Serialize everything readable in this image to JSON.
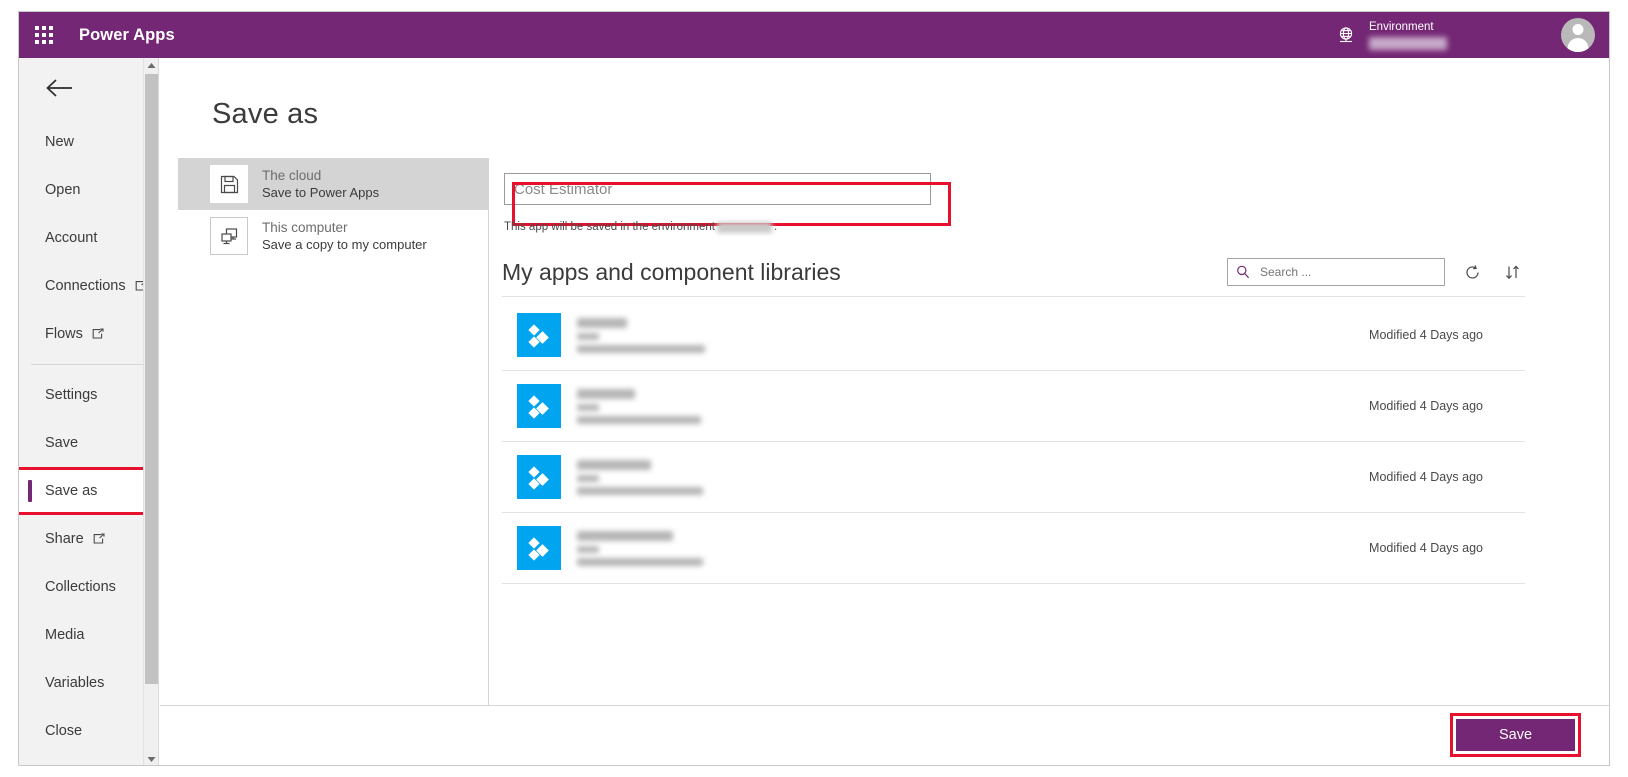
{
  "header": {
    "waffle_icon": "app-launcher-waffle-icon",
    "brand": "Power Apps",
    "environment_icon": "globe-environment-icon",
    "environment_label": "Environment",
    "environment_value": "",
    "avatar_icon": "user-avatar-icon"
  },
  "sidebar": {
    "back_icon": "back-arrow-icon",
    "items": [
      {
        "label": "New",
        "external": false,
        "selected": false
      },
      {
        "label": "Open",
        "external": false,
        "selected": false
      },
      {
        "label": "Account",
        "external": false,
        "selected": false
      },
      {
        "label": "Connections",
        "external": true,
        "selected": false
      },
      {
        "label": "Flows",
        "external": true,
        "selected": false
      },
      {
        "label": "Settings",
        "external": false,
        "selected": false
      },
      {
        "label": "Save",
        "external": false,
        "selected": false
      },
      {
        "label": "Save as",
        "external": false,
        "selected": true
      },
      {
        "label": "Share",
        "external": true,
        "selected": false
      },
      {
        "label": "Collections",
        "external": false,
        "selected": false
      },
      {
        "label": "Media",
        "external": false,
        "selected": false
      },
      {
        "label": "Variables",
        "external": false,
        "selected": false
      },
      {
        "label": "Close",
        "external": false,
        "selected": false
      }
    ],
    "scrollbar": {
      "up_icon": "scroll-up-arrow-icon",
      "down_icon": "scroll-down-arrow-icon"
    }
  },
  "main": {
    "title": "Save as",
    "destinations": [
      {
        "title": "The cloud",
        "subtitle": "Save to Power Apps",
        "icon": "floppy-disk-save-icon",
        "active": true
      },
      {
        "title": "This computer",
        "subtitle": "Save a copy to my computer",
        "icon": "desktop-computer-icon",
        "active": false
      }
    ],
    "app_name": {
      "value": "Cost Estimator",
      "placeholder": "App name"
    },
    "hint_prefix": "This app will be saved in the environment",
    "hint_suffix": ".",
    "list": {
      "title": "My apps and component libraries",
      "search_placeholder": "Search ...",
      "search_value": "",
      "search_icon": "search-icon",
      "refresh_icon": "refresh-icon",
      "sort_icon": "sort-icon",
      "rows": [
        {
          "icon": "power-app-tile-icon",
          "name": "",
          "modified": "Modified 4 Days ago"
        },
        {
          "icon": "power-app-tile-icon",
          "name": "",
          "modified": "Modified 4 Days ago"
        },
        {
          "icon": "power-app-tile-icon",
          "name": "",
          "modified": "Modified 4 Days ago"
        },
        {
          "icon": "power-app-tile-icon",
          "name": "",
          "modified": "Modified 4 Days ago"
        }
      ]
    },
    "save_button": "Save"
  },
  "colors": {
    "brand_purple": "#742774",
    "annotation_red": "#e8112d",
    "app_tile_blue": "#00a4ef",
    "sidebar_bg": "#f2f2f2"
  }
}
